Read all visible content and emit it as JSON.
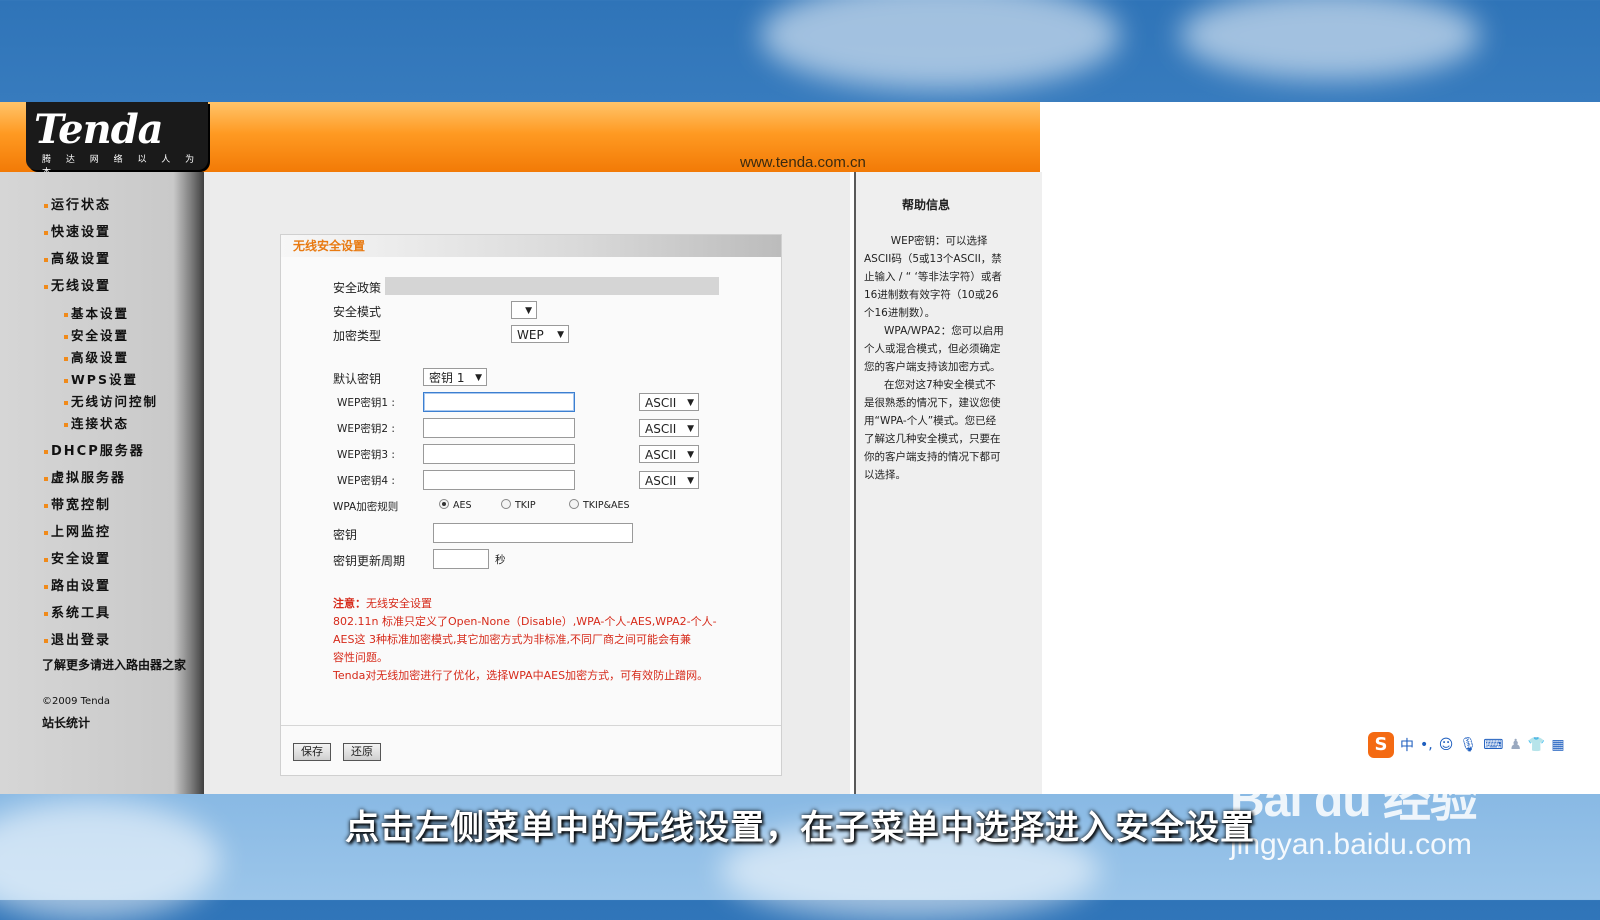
{
  "header": {
    "logo_text": "Tenda",
    "logo_slogan": "腾 达 网 络 以 人 为 本",
    "url": "www.tenda.com.cn"
  },
  "nav": {
    "items": [
      "运行状态",
      "快速设置",
      "高级设置",
      "无线设置"
    ],
    "sub_items": [
      "基本设置",
      "安全设置",
      "高级设置",
      "WPS设置",
      "无线访问控制",
      "连接状态"
    ],
    "items2": [
      "DHCP服务器",
      "虚拟服务器",
      "带宽控制",
      "上网监控",
      "安全设置",
      "路由设置",
      "系统工具",
      "退出登录"
    ],
    "more_link": "了解更多请进入路由器之家",
    "copyright": "©2009 Tenda",
    "stats": "站长统计"
  },
  "panel": {
    "title": "无线安全设置",
    "security_policy_label": "安全政策",
    "security_mode_label": "安全模式",
    "encryption_type_label": "加密类型",
    "encryption_type_value": "WEP",
    "default_key_label": "默认密钥",
    "default_key_value": "密钥 1",
    "wep_keys": [
      {
        "label": "WEP密钥1 :",
        "format": "ASCII"
      },
      {
        "label": "WEP密钥2 :",
        "format": "ASCII"
      },
      {
        "label": "WEP密钥3 :",
        "format": "ASCII"
      },
      {
        "label": "WEP密钥4 :",
        "format": "ASCII"
      }
    ],
    "wpa_rule_label": "WPA加密规则",
    "wpa_options": [
      "AES",
      "TKIP",
      "TKIP&AES"
    ],
    "wpa_selected": "AES",
    "key_label": "密钥",
    "key_renew_label": "密钥更新周期",
    "key_renew_unit": "秒",
    "note_title": "注意：",
    "note_subtitle": "无线安全设置",
    "note_line1": "802.11n 标准只定义了Open-None（Disable）,WPA-个人-AES,WPA2-个人-",
    "note_line2": "AES这 3种标准加密模式,其它加密方式为非标准,不同厂商之间可能会有兼",
    "note_line3": "容性问题。",
    "note_line4": "Tenda对无线加密进行了优化，选择WPA中AES加密方式，可有效防止蹭网。",
    "save_label": "保存",
    "restore_label": "还原"
  },
  "help": {
    "title": "帮助信息",
    "text": "        WEP密钥：可以选择ASCII码（5或13个ASCII，禁止输入 / “ ‘等非法字符）或者16进制数有效字符（10或26个16进制数）。\n      WPA/WPA2：您可以启用个人或混合模式，但必须确定您的客户端支持该加密方式。\n      在您对这7种安全模式不是很熟悉的情况下，建议您使用“WPA-个人”模式。您已经了解这几种安全模式，只要在你的客户端支持的情况下都可以选择。"
  },
  "ime": {
    "logo": "S",
    "lang": "中"
  },
  "watermark": {
    "brand": "Bai du 经验",
    "url": "jingyan.baidu.com"
  },
  "caption": "点击左侧菜单中的无线设置，在子菜单中选择进入安全设置"
}
